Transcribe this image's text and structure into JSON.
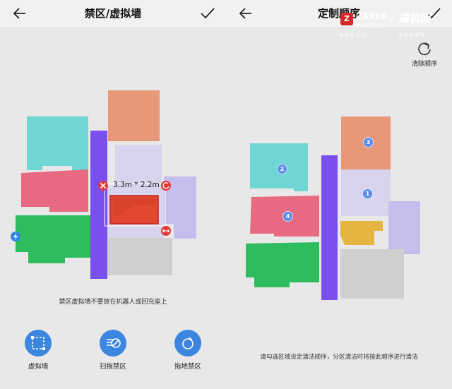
{
  "left": {
    "title": "禁区/虚拟墙",
    "zone_size": "3.3m * 2.2m",
    "tip": "禁区虚拟墙不要放在机器人或回充座上",
    "tools": [
      {
        "label": "虚拟墙",
        "icon": "virtual-wall-icon"
      },
      {
        "label": "扫拖禁区",
        "icon": "no-sweep-zone-icon"
      },
      {
        "label": "拖地禁区",
        "icon": "no-mop-zone-icon"
      }
    ]
  },
  "right": {
    "title": "定制顺序",
    "reset_label": "清除顺序",
    "tip": "请勾选区域设定清洁顺序，分区清洁时将按此顺序进行清洁",
    "order_badges": [
      "1",
      "2",
      "3",
      "4"
    ]
  },
  "watermark": {
    "brand": "ZAKER",
    "brand_sub": "新闻扫描团队",
    "times": "×",
    "partner": "搞机团",
    "slogan_left": "极 致 天 上 信",
    "slogan_right": "搞 机 有 解 释"
  },
  "colors": {
    "accent": "#3c86e0",
    "wall": "#7a4ff0",
    "cyan": "#6ed6d3",
    "pink": "#e86a82",
    "green": "#2ebd5e",
    "orange": "#e89878",
    "lavender": "#c7bdec",
    "yellow": "#e6b441",
    "gray": "#cfcfcf",
    "zone": "#e2472f"
  }
}
